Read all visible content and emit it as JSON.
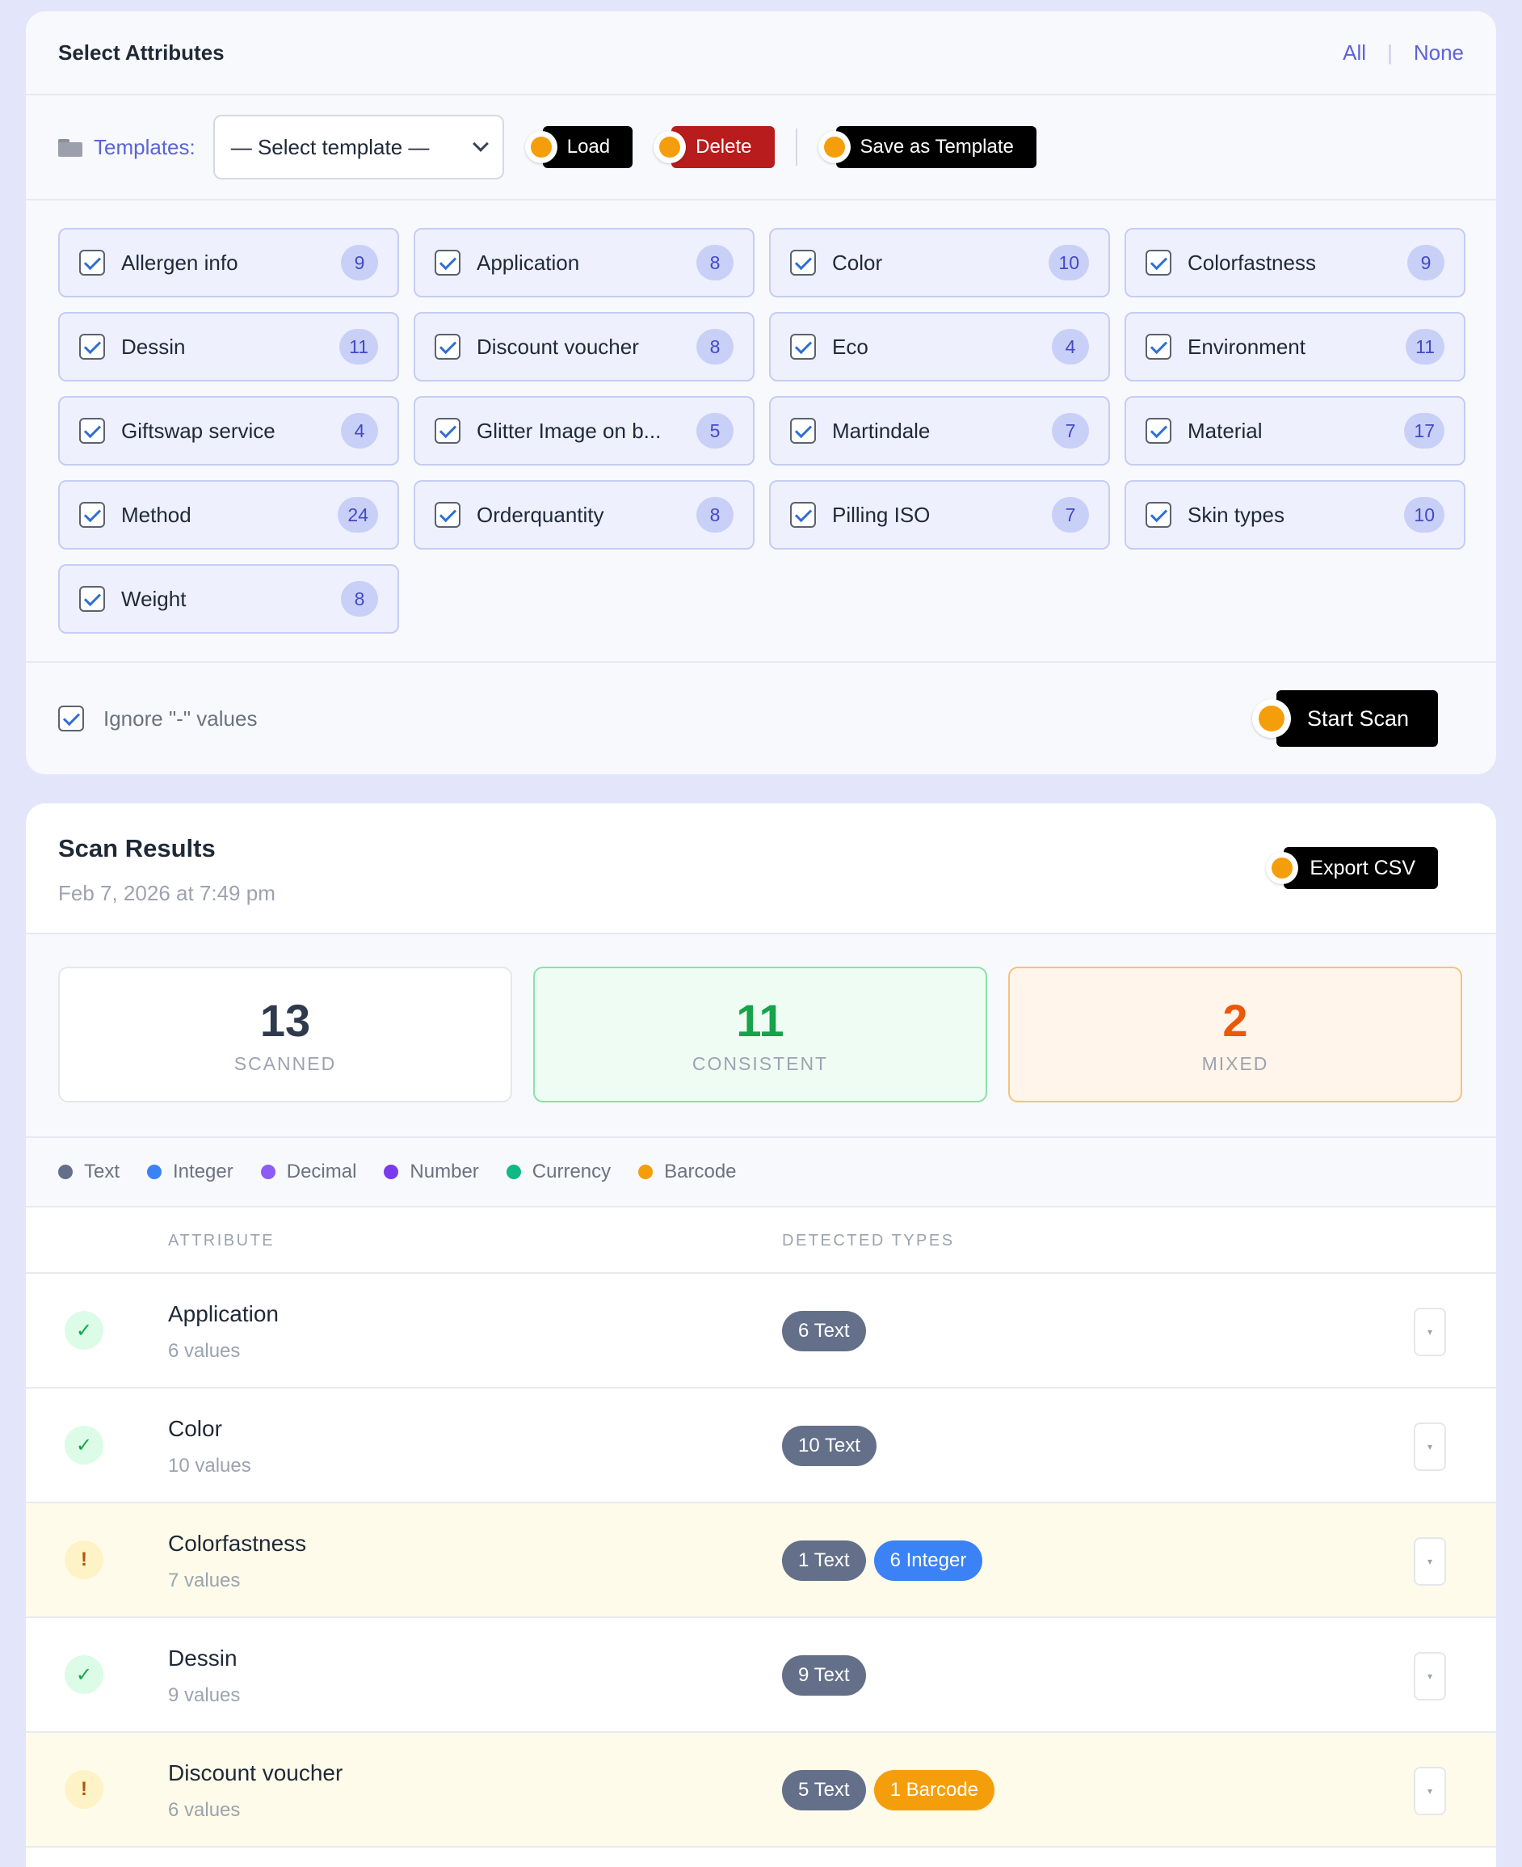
{
  "attributes_card": {
    "title": "Select Attributes",
    "all_label": "All",
    "none_label": "None",
    "templates_label": "Templates:",
    "template_select_value": "— Select template —",
    "load_label": "Load",
    "delete_label": "Delete",
    "save_template_label": "Save as Template",
    "attributes": [
      {
        "name": "Allergen info",
        "count": "9",
        "checked": true
      },
      {
        "name": "Application",
        "count": "8",
        "checked": true
      },
      {
        "name": "Color",
        "count": "10",
        "checked": true
      },
      {
        "name": "Colorfastness",
        "count": "9",
        "checked": true
      },
      {
        "name": "Dessin",
        "count": "11",
        "checked": true
      },
      {
        "name": "Discount voucher",
        "count": "8",
        "checked": true
      },
      {
        "name": "Eco",
        "count": "4",
        "checked": true
      },
      {
        "name": "Environment",
        "count": "11",
        "checked": true
      },
      {
        "name": "Giftswap service",
        "count": "4",
        "checked": true
      },
      {
        "name": "Glitter Image on b...",
        "count": "5",
        "checked": true
      },
      {
        "name": "Martindale",
        "count": "7",
        "checked": true
      },
      {
        "name": "Material",
        "count": "17",
        "checked": true
      },
      {
        "name": "Method",
        "count": "24",
        "checked": true
      },
      {
        "name": "Orderquantity",
        "count": "8",
        "checked": true
      },
      {
        "name": "Pilling ISO",
        "count": "7",
        "checked": true
      },
      {
        "name": "Skin types",
        "count": "10",
        "checked": true
      },
      {
        "name": "Weight",
        "count": "8",
        "checked": true
      }
    ],
    "ignore_label": "Ignore \"-\" values",
    "ignore_checked": true,
    "start_scan_label": "Start Scan"
  },
  "results_card": {
    "title": "Scan Results",
    "date": "Feb 7, 2026 at 7:49 pm",
    "export_label": "Export CSV",
    "stats": {
      "scanned": {
        "value": "13",
        "label": "SCANNED"
      },
      "consistent": {
        "value": "11",
        "label": "CONSISTENT"
      },
      "mixed": {
        "value": "2",
        "label": "MIXED"
      }
    },
    "legend": [
      {
        "label": "Text",
        "color": "#64708a"
      },
      {
        "label": "Integer",
        "color": "#3b82f6"
      },
      {
        "label": "Decimal",
        "color": "#8b5cf6"
      },
      {
        "label": "Number",
        "color": "#7c3aed"
      },
      {
        "label": "Currency",
        "color": "#10b981"
      },
      {
        "label": "Barcode",
        "color": "#f59e0b"
      }
    ],
    "columns": {
      "attribute": "ATTRIBUTE",
      "detected_types": "DETECTED TYPES"
    },
    "rows": [
      {
        "name": "Application",
        "values": "6 values",
        "status": "ok",
        "tags": [
          {
            "label": "6 Text",
            "type": "text"
          }
        ]
      },
      {
        "name": "Color",
        "values": "10 values",
        "status": "ok",
        "tags": [
          {
            "label": "10 Text",
            "type": "text"
          }
        ]
      },
      {
        "name": "Colorfastness",
        "values": "7 values",
        "status": "warn",
        "tags": [
          {
            "label": "1 Text",
            "type": "text"
          },
          {
            "label": "6 Integer",
            "type": "integer"
          }
        ]
      },
      {
        "name": "Dessin",
        "values": "9 values",
        "status": "ok",
        "tags": [
          {
            "label": "9 Text",
            "type": "text"
          }
        ]
      },
      {
        "name": "Discount voucher",
        "values": "6 values",
        "status": "warn",
        "tags": [
          {
            "label": "5 Text",
            "type": "text"
          },
          {
            "label": "1 Barcode",
            "type": "barcode"
          }
        ]
      }
    ],
    "status_icons": {
      "ok": "✓",
      "warn": "!"
    },
    "expand_icon": "▾"
  },
  "colors": {
    "accent": "#5b63d6",
    "orange_dot": "#f59e0b",
    "delete_red": "#b91c1c",
    "page_bg": "#e3e6fb"
  }
}
